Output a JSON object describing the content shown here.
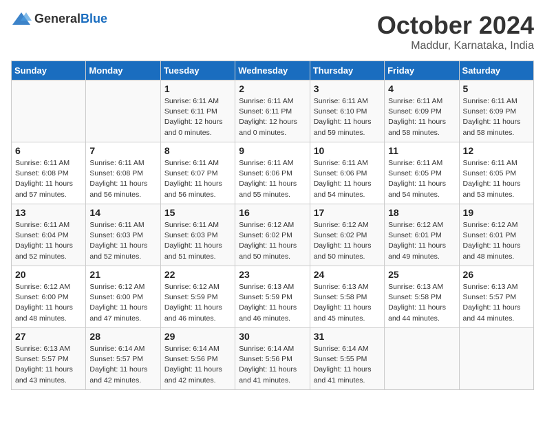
{
  "header": {
    "logo_general": "General",
    "logo_blue": "Blue",
    "month": "October 2024",
    "location": "Maddur, Karnataka, India"
  },
  "weekdays": [
    "Sunday",
    "Monday",
    "Tuesday",
    "Wednesday",
    "Thursday",
    "Friday",
    "Saturday"
  ],
  "weeks": [
    [
      {
        "day": "",
        "info": ""
      },
      {
        "day": "",
        "info": ""
      },
      {
        "day": "1",
        "info": "Sunrise: 6:11 AM\nSunset: 6:11 PM\nDaylight: 12 hours\nand 0 minutes."
      },
      {
        "day": "2",
        "info": "Sunrise: 6:11 AM\nSunset: 6:11 PM\nDaylight: 12 hours\nand 0 minutes."
      },
      {
        "day": "3",
        "info": "Sunrise: 6:11 AM\nSunset: 6:10 PM\nDaylight: 11 hours\nand 59 minutes."
      },
      {
        "day": "4",
        "info": "Sunrise: 6:11 AM\nSunset: 6:09 PM\nDaylight: 11 hours\nand 58 minutes."
      },
      {
        "day": "5",
        "info": "Sunrise: 6:11 AM\nSunset: 6:09 PM\nDaylight: 11 hours\nand 58 minutes."
      }
    ],
    [
      {
        "day": "6",
        "info": "Sunrise: 6:11 AM\nSunset: 6:08 PM\nDaylight: 11 hours\nand 57 minutes."
      },
      {
        "day": "7",
        "info": "Sunrise: 6:11 AM\nSunset: 6:08 PM\nDaylight: 11 hours\nand 56 minutes."
      },
      {
        "day": "8",
        "info": "Sunrise: 6:11 AM\nSunset: 6:07 PM\nDaylight: 11 hours\nand 56 minutes."
      },
      {
        "day": "9",
        "info": "Sunrise: 6:11 AM\nSunset: 6:06 PM\nDaylight: 11 hours\nand 55 minutes."
      },
      {
        "day": "10",
        "info": "Sunrise: 6:11 AM\nSunset: 6:06 PM\nDaylight: 11 hours\nand 54 minutes."
      },
      {
        "day": "11",
        "info": "Sunrise: 6:11 AM\nSunset: 6:05 PM\nDaylight: 11 hours\nand 54 minutes."
      },
      {
        "day": "12",
        "info": "Sunrise: 6:11 AM\nSunset: 6:05 PM\nDaylight: 11 hours\nand 53 minutes."
      }
    ],
    [
      {
        "day": "13",
        "info": "Sunrise: 6:11 AM\nSunset: 6:04 PM\nDaylight: 11 hours\nand 52 minutes."
      },
      {
        "day": "14",
        "info": "Sunrise: 6:11 AM\nSunset: 6:03 PM\nDaylight: 11 hours\nand 52 minutes."
      },
      {
        "day": "15",
        "info": "Sunrise: 6:11 AM\nSunset: 6:03 PM\nDaylight: 11 hours\nand 51 minutes."
      },
      {
        "day": "16",
        "info": "Sunrise: 6:12 AM\nSunset: 6:02 PM\nDaylight: 11 hours\nand 50 minutes."
      },
      {
        "day": "17",
        "info": "Sunrise: 6:12 AM\nSunset: 6:02 PM\nDaylight: 11 hours\nand 50 minutes."
      },
      {
        "day": "18",
        "info": "Sunrise: 6:12 AM\nSunset: 6:01 PM\nDaylight: 11 hours\nand 49 minutes."
      },
      {
        "day": "19",
        "info": "Sunrise: 6:12 AM\nSunset: 6:01 PM\nDaylight: 11 hours\nand 48 minutes."
      }
    ],
    [
      {
        "day": "20",
        "info": "Sunrise: 6:12 AM\nSunset: 6:00 PM\nDaylight: 11 hours\nand 48 minutes."
      },
      {
        "day": "21",
        "info": "Sunrise: 6:12 AM\nSunset: 6:00 PM\nDaylight: 11 hours\nand 47 minutes."
      },
      {
        "day": "22",
        "info": "Sunrise: 6:12 AM\nSunset: 5:59 PM\nDaylight: 11 hours\nand 46 minutes."
      },
      {
        "day": "23",
        "info": "Sunrise: 6:13 AM\nSunset: 5:59 PM\nDaylight: 11 hours\nand 46 minutes."
      },
      {
        "day": "24",
        "info": "Sunrise: 6:13 AM\nSunset: 5:58 PM\nDaylight: 11 hours\nand 45 minutes."
      },
      {
        "day": "25",
        "info": "Sunrise: 6:13 AM\nSunset: 5:58 PM\nDaylight: 11 hours\nand 44 minutes."
      },
      {
        "day": "26",
        "info": "Sunrise: 6:13 AM\nSunset: 5:57 PM\nDaylight: 11 hours\nand 44 minutes."
      }
    ],
    [
      {
        "day": "27",
        "info": "Sunrise: 6:13 AM\nSunset: 5:57 PM\nDaylight: 11 hours\nand 43 minutes."
      },
      {
        "day": "28",
        "info": "Sunrise: 6:14 AM\nSunset: 5:57 PM\nDaylight: 11 hours\nand 42 minutes."
      },
      {
        "day": "29",
        "info": "Sunrise: 6:14 AM\nSunset: 5:56 PM\nDaylight: 11 hours\nand 42 minutes."
      },
      {
        "day": "30",
        "info": "Sunrise: 6:14 AM\nSunset: 5:56 PM\nDaylight: 11 hours\nand 41 minutes."
      },
      {
        "day": "31",
        "info": "Sunrise: 6:14 AM\nSunset: 5:55 PM\nDaylight: 11 hours\nand 41 minutes."
      },
      {
        "day": "",
        "info": ""
      },
      {
        "day": "",
        "info": ""
      }
    ]
  ]
}
